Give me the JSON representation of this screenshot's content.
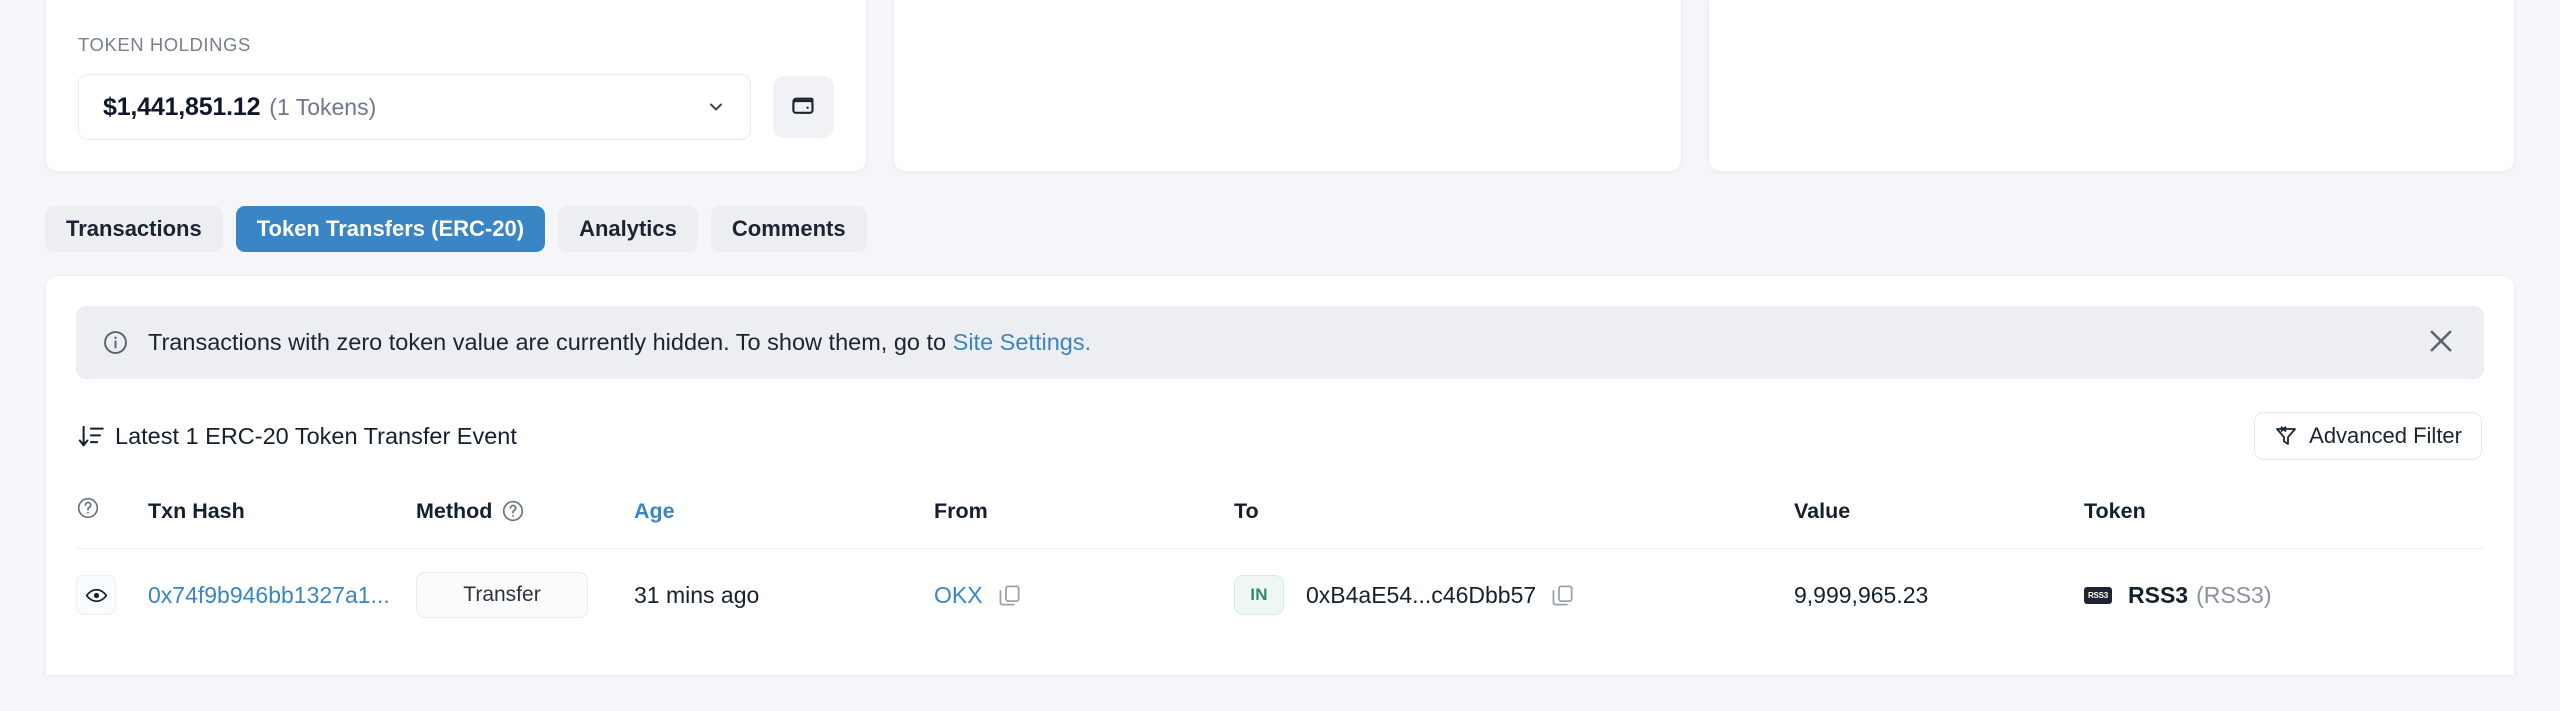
{
  "overview_card": {
    "label": "TOKEN HOLDINGS",
    "holdings_amount": "$1,441,851.12",
    "holdings_count": "(1 Tokens)",
    "chevron_icon": "chevron-down-icon",
    "wallet_icon": "wallet-icon"
  },
  "tabs": [
    {
      "label": "Transactions",
      "active": false
    },
    {
      "label": "Token Transfers (ERC-20)",
      "active": true
    },
    {
      "label": "Analytics",
      "active": false
    },
    {
      "label": "Comments",
      "active": false
    }
  ],
  "banner": {
    "info_icon": "info-circle-icon",
    "text": "Transactions with zero token value are currently hidden. To show them, go to ",
    "link_label": "Site Settings.",
    "close_icon": "close-icon"
  },
  "summary": {
    "sort_icon": "sort-descending-icon",
    "text": "Latest 1 ERC-20 Token Transfer Event",
    "filter_icon": "funnel-icon",
    "filter_label": "Advanced Filter"
  },
  "table": {
    "columns": [
      {
        "label": "",
        "help": true
      },
      {
        "label": "Txn Hash",
        "help": false
      },
      {
        "label": "Method",
        "help": true
      },
      {
        "label": "Age",
        "help": false,
        "link": true
      },
      {
        "label": "From",
        "help": false
      },
      {
        "label": "To",
        "help": false
      },
      {
        "label": "Value",
        "help": false
      },
      {
        "label": "Token",
        "help": false
      }
    ],
    "rows": [
      {
        "eye_icon": "eye-icon",
        "txn_hash": "0x74f9b946bb1327a1...",
        "method": "Transfer",
        "age": "31 mins ago",
        "from": "OKX",
        "from_copy_icon": "copy-icon",
        "direction": "IN",
        "to": "0xB4aE54...c46Dbb57",
        "to_copy_icon": "copy-icon",
        "value": "9,999,965.23",
        "token_logo_text": "RSS3",
        "token_name": "RSS3",
        "token_symbol": "(RSS3)"
      }
    ]
  },
  "colors": {
    "accent": "#3a85c4",
    "page_bg": "#f4f6f9",
    "card_bg": "#ffffff",
    "banner_bg": "#eceef2",
    "tab_bg": "#eceef2",
    "in_badge_text": "#2e8b68",
    "in_badge_bg": "#eef7f2",
    "muted_text": "#77808f"
  }
}
